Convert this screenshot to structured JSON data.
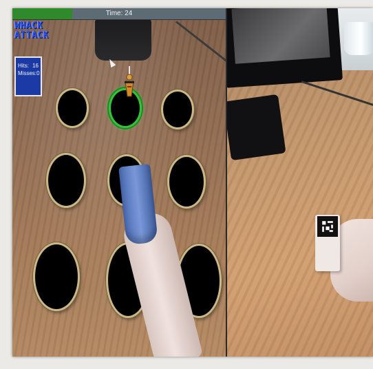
{
  "hud": {
    "time_label": "Time: 24",
    "time_progress": 0.28,
    "time_bar_color": "#2e8a2a"
  },
  "logo": {
    "line1": "WHACK",
    "line2": "ATTACK"
  },
  "score": {
    "hits_label": "Hits:",
    "hits_value": "16",
    "misses_label": "Misses:",
    "misses_value": "0"
  },
  "board": {
    "rows": 3,
    "cols": 3,
    "active_hole": 1,
    "active_color": "#35c23a",
    "rim_color": "#cbb889"
  },
  "icons": {
    "pointer": "cursor-arrow-icon",
    "mole": "mole-icon",
    "marker": "ar-marker-icon"
  }
}
